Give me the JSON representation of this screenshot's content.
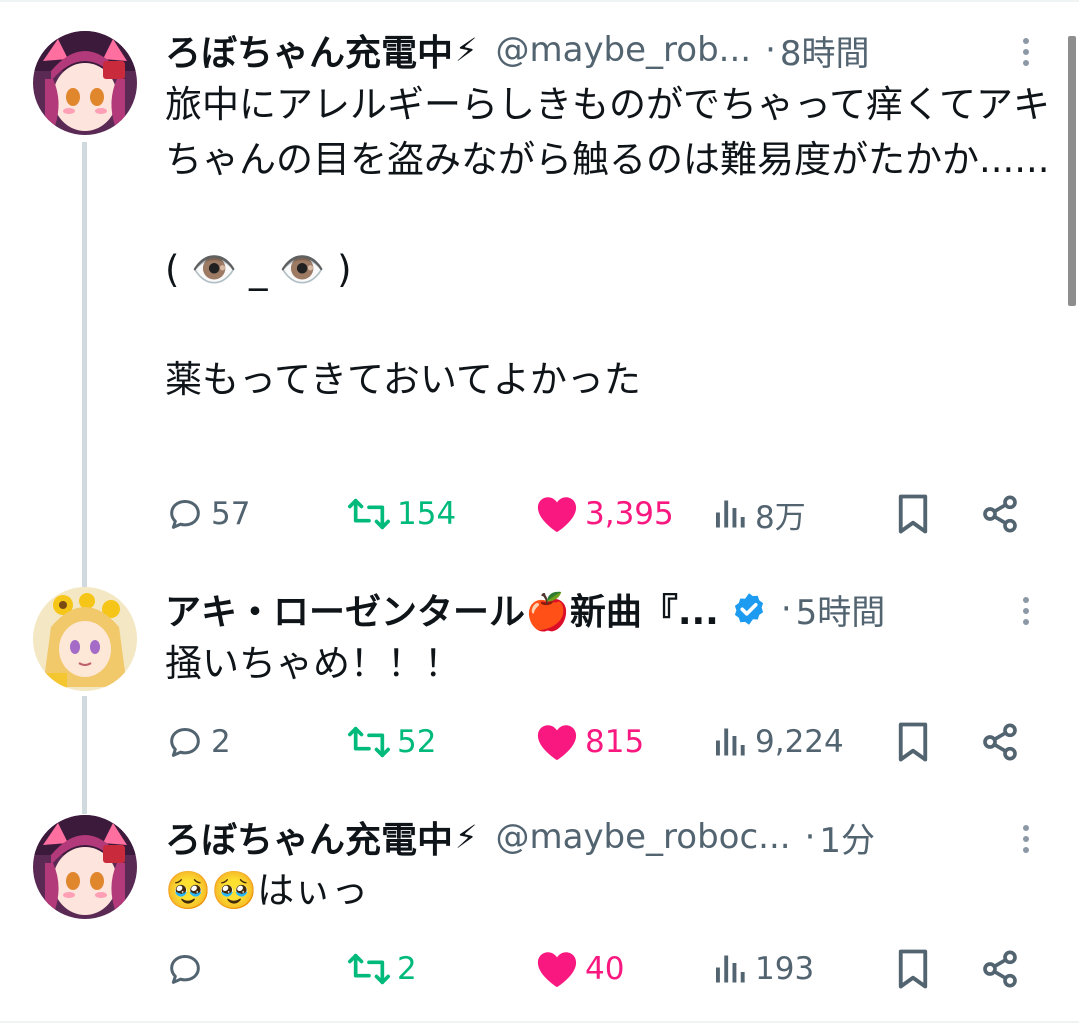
{
  "tweets": [
    {
      "name": "ろぼちゃん充電中",
      "name_emoji": "⚡",
      "handle": "@maybe_rob...",
      "separator": "·",
      "time": "8時間",
      "text": "旅中にアレルギーらしきものがでちゃって痒くてアキちゃんの目を盗みながら触るのは難易度がたかか......\n\n( 👁️ _ 👁️ )\n\n薬もってきておいてよかった",
      "replies": "57",
      "retweets": "154",
      "likes": "3,395",
      "views": "8万"
    },
    {
      "name": "アキ・ローゼンタール🍎新曲『...",
      "verified": true,
      "separator": "·",
      "time": "5時間",
      "text": "掻いちゃめ！！！",
      "replies": "2",
      "retweets": "52",
      "likes": "815",
      "views": "9,224"
    },
    {
      "name": "ろぼちゃん充電中",
      "name_emoji": "⚡",
      "handle": "@maybe_roboc...",
      "separator": "·",
      "time": "1分",
      "text": "🥹🥹はぃっ",
      "replies": "",
      "retweets": "2",
      "likes": "40",
      "views": "193"
    }
  ],
  "icons": [
    "reply-icon",
    "retweet-icon",
    "like-icon",
    "views-icon",
    "bookmark-icon",
    "share-icon",
    "more-icon",
    "verified-icon"
  ],
  "colors": {
    "retweet": "#00ba7c",
    "like": "#f91880",
    "muted": "#536471",
    "verified": "#1d9bf0"
  }
}
